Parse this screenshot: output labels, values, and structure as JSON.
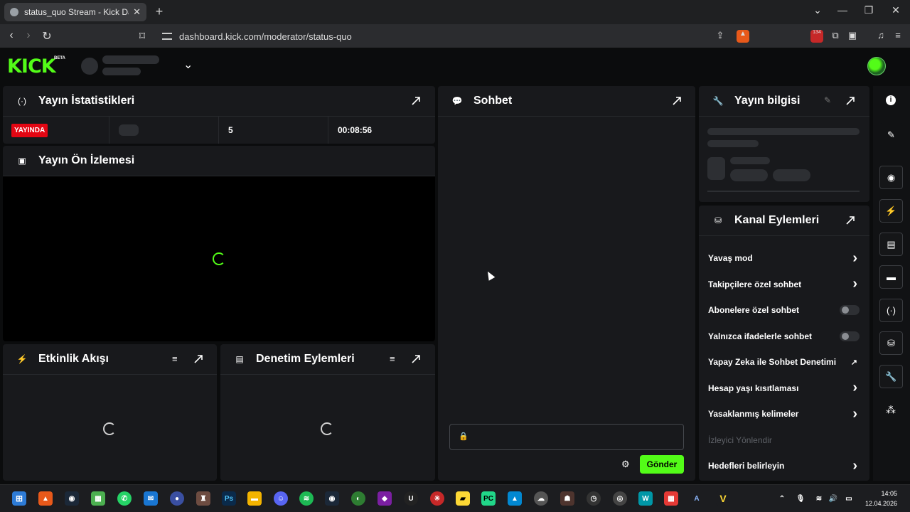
{
  "browser": {
    "tab_title": "status_quo Stream - Kick Dashbo",
    "url": "dashboard.kick.com/moderator/status-quo",
    "extension_badge": "134"
  },
  "header": {
    "logo": "KICK",
    "logo_badge": "BETA"
  },
  "stats": {
    "title": "Yayın İstatistikleri",
    "live_badge": "YAYINDA",
    "viewers": "5",
    "uptime": "00:08:56"
  },
  "preview": {
    "title": "Yayın Ön İzlemesi"
  },
  "activity": {
    "title": "Etkinlik Akışı"
  },
  "moderation": {
    "title": "Denetim Eylemleri"
  },
  "chat": {
    "title": "Sohbet",
    "send_label": "Gönder"
  },
  "stream_info": {
    "title": "Yayın bilgisi"
  },
  "channel_actions": {
    "title": "Kanal Eylemleri",
    "items": [
      {
        "label": "Yavaş mod",
        "control": "chevron"
      },
      {
        "label": "Takipçilere özel sohbet",
        "control": "chevron"
      },
      {
        "label": "Abonelere özel sohbet",
        "control": "toggle-off"
      },
      {
        "label": "Yalnızca ifadelerle sohbet",
        "control": "toggle-off"
      },
      {
        "label": "Yapay Zeka ile Sohbet Denetimi",
        "control": "external"
      },
      {
        "label": "Hesap yaşı kısıtlaması",
        "control": "chevron"
      },
      {
        "label": "Yasaklanmış kelimeler",
        "control": "chevron"
      },
      {
        "label": "İzleyici Yönlendir",
        "control": "disabled"
      },
      {
        "label": "Hedefleri belirleyin",
        "control": "chevron"
      }
    ]
  },
  "taskbar": {
    "time": "14:05",
    "date": "12.04.2026"
  },
  "colors": {
    "accent": "#53fc18",
    "live": "#e30613",
    "panel": "#18191c",
    "background": "#0b0c0d"
  }
}
